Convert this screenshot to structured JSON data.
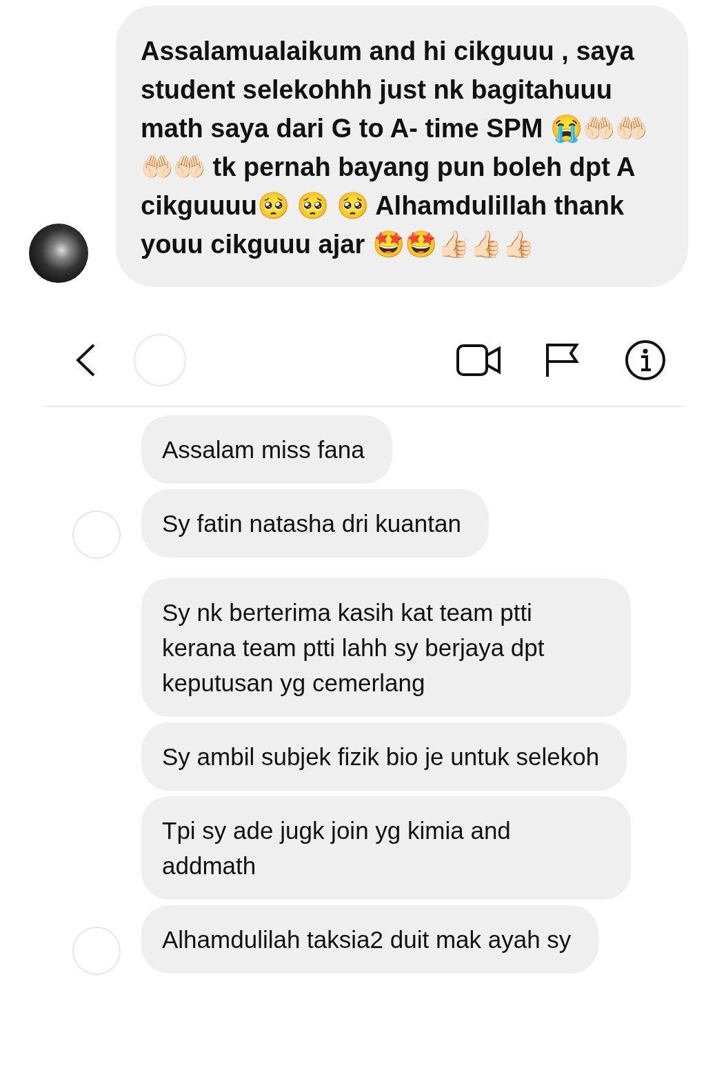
{
  "top_message": {
    "text": "Assalamualaikum and hi cikguuu , saya student selekohhh just nk bagitahuuu math saya dari G to A- time SPM 😭🤲🏻🤲🏻🤲🏻🤲🏻 tk pernah bayang pun boleh dpt A cikguuuu🥺 🥺 🥺 Alhamdulillah  thank youu cikguuu ajar 🤩🤩👍🏻👍🏻👍🏻"
  },
  "groups": [
    {
      "messages": [
        "Assalam miss fana",
        "Sy fatin natasha dri kuantan"
      ]
    },
    {
      "messages": [
        "Sy nk berterima kasih kat team ptti kerana team ptti lahh sy berjaya dpt keputusan yg cemerlang",
        "Sy ambil subjek fizik bio je untuk selekoh",
        "Tpi sy ade jugk join yg kimia and addmath",
        "Alhamdulilah taksia2 duit mak ayah sy"
      ]
    }
  ]
}
